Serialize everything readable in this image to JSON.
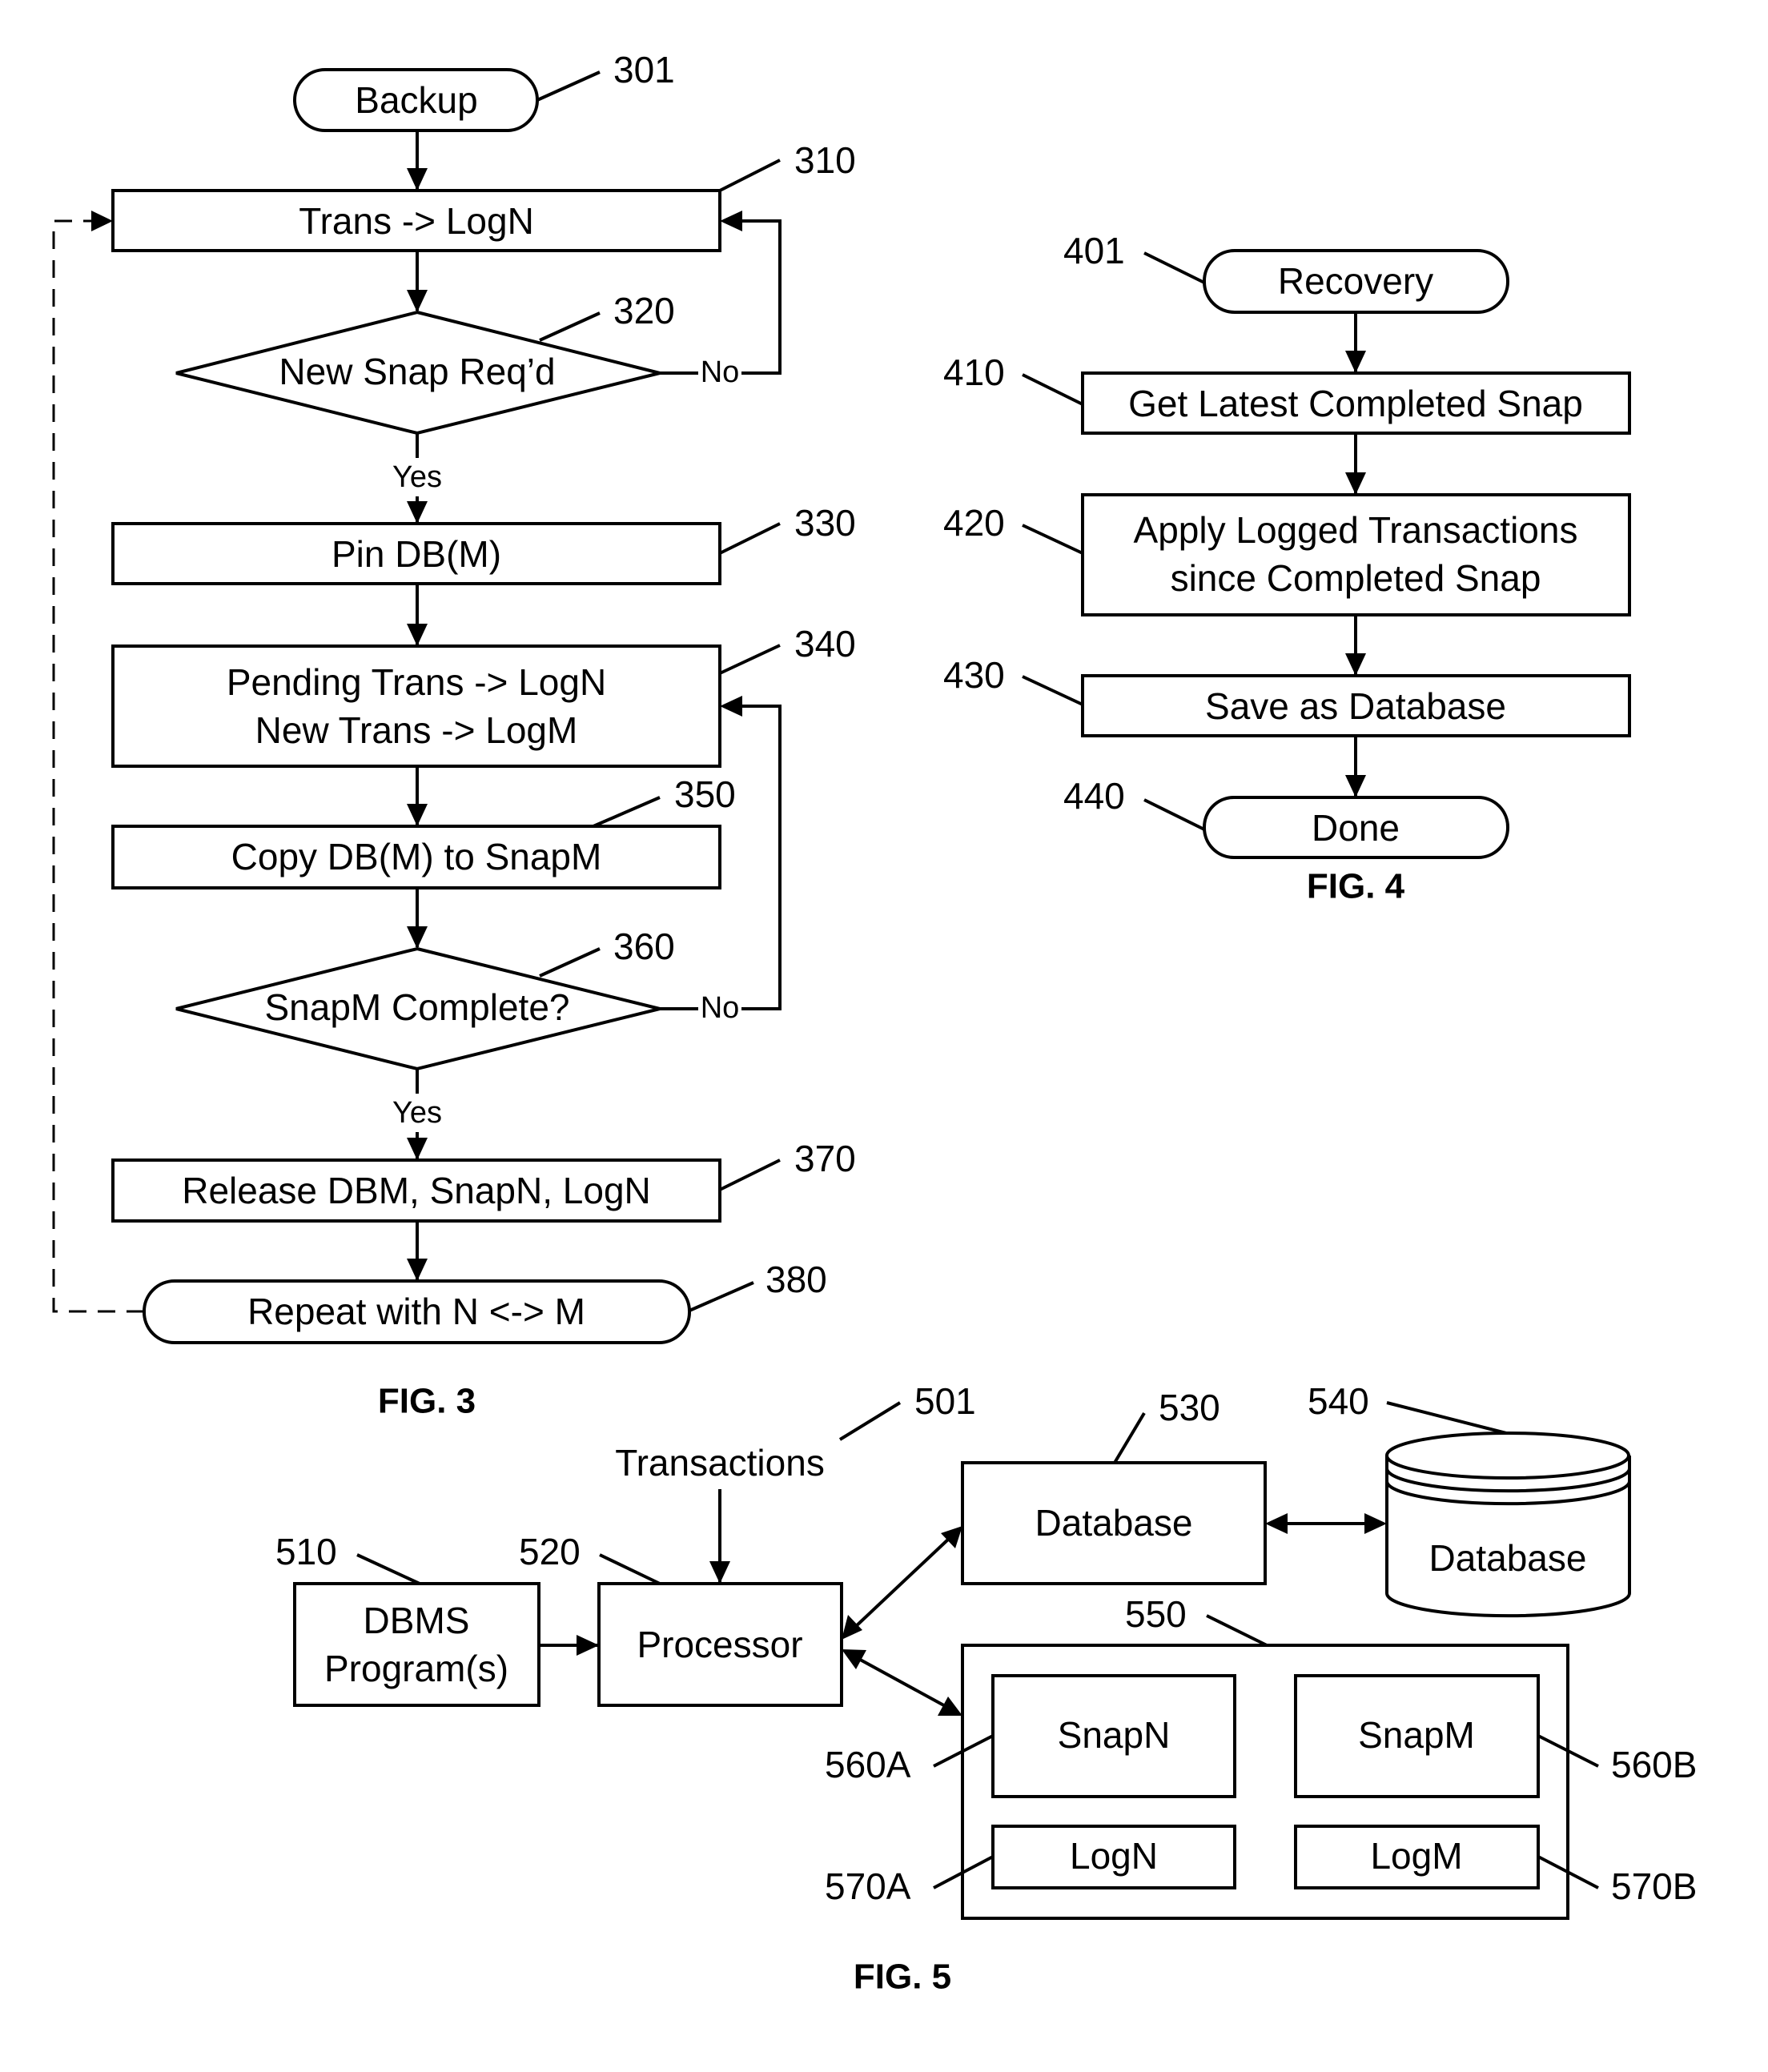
{
  "fig3": {
    "caption": "FIG. 3",
    "start": {
      "label": "Backup",
      "ref": "301"
    },
    "step310": {
      "label": "Trans -> LogN",
      "ref": "310"
    },
    "decision320": {
      "label": "New Snap Req’d",
      "ref": "320",
      "yes": "Yes",
      "no": "No"
    },
    "step330": {
      "label": "Pin DB(M)",
      "ref": "330"
    },
    "step340": {
      "line1": "Pending Trans -> LogN",
      "line2": "New Trans -> LogM",
      "ref": "340"
    },
    "step350": {
      "label": "Copy DB(M) to SnapM",
      "ref": "350"
    },
    "decision360": {
      "label": "SnapM Complete?",
      "ref": "360",
      "yes": "Yes",
      "no": "No"
    },
    "step370": {
      "label": "Release DBM, SnapN, LogN",
      "ref": "370"
    },
    "end380": {
      "label": "Repeat with N <-> M",
      "ref": "380"
    }
  },
  "fig4": {
    "caption": "FIG. 4",
    "start": {
      "label": "Recovery",
      "ref": "401"
    },
    "step410": {
      "label": "Get Latest Completed Snap",
      "ref": "410"
    },
    "step420": {
      "line1": "Apply Logged Transactions",
      "line2": "since Completed Snap",
      "ref": "420"
    },
    "step430": {
      "label": "Save as Database",
      "ref": "430"
    },
    "end440": {
      "label": "Done",
      "ref": "440"
    }
  },
  "fig5": {
    "caption": "FIG. 5",
    "transactions": {
      "label": "Transactions",
      "ref": "501"
    },
    "dbms": {
      "line1": "DBMS",
      "line2": "Program(s)",
      "ref": "510"
    },
    "processor": {
      "label": "Processor",
      "ref": "520"
    },
    "database": {
      "label": "Database",
      "ref": "530"
    },
    "storage": {
      "label": "Database",
      "ref": "540"
    },
    "container": {
      "ref": "550"
    },
    "snapN": {
      "label": "SnapN",
      "ref": "560A"
    },
    "snapM": {
      "label": "SnapM",
      "ref": "560B"
    },
    "logN": {
      "label": "LogN",
      "ref": "570A"
    },
    "logM": {
      "label": "LogM",
      "ref": "570B"
    }
  }
}
